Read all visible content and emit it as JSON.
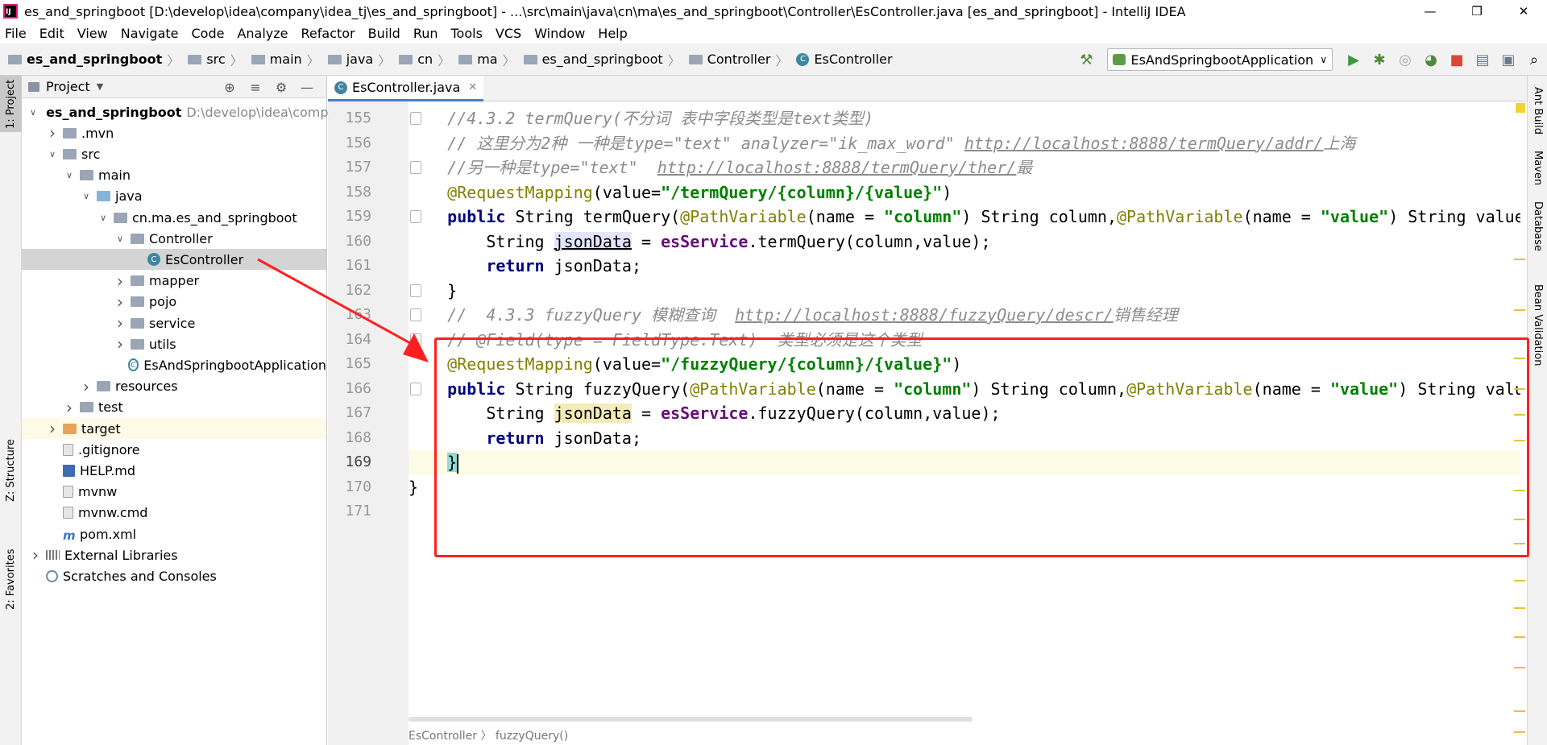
{
  "window": {
    "title": "es_and_springboot [D:\\develop\\idea\\company\\idea_tj\\es_and_springboot] - ...\\src\\main\\java\\cn\\ma\\es_and_springboot\\Controller\\EsController.java [es_and_springboot] - IntelliJ IDEA",
    "app_icon_label": "IJ"
  },
  "menu": [
    "File",
    "Edit",
    "View",
    "Navigate",
    "Code",
    "Analyze",
    "Refactor",
    "Build",
    "Run",
    "Tools",
    "VCS",
    "Window",
    "Help"
  ],
  "breadcrumb": [
    "es_and_springboot",
    "src",
    "main",
    "java",
    "cn",
    "ma",
    "es_and_springboot",
    "Controller",
    "EsController"
  ],
  "run_config": "EsAndSpringbootApplication",
  "left_strip": {
    "project": "1: Project",
    "structure": "Z: Structure",
    "favorites": "2: Favorites"
  },
  "right_strip": [
    "Ant Build",
    "Maven",
    "Database",
    "Bean Validation"
  ],
  "project_panel": {
    "title": "Project",
    "tree": [
      {
        "label": "es_and_springboot",
        "extra": "D:\\develop\\idea\\company",
        "depth": 0,
        "arrow": "down",
        "icon": "grey",
        "bold": true
      },
      {
        "label": ".mvn",
        "depth": 1,
        "arrow": "right",
        "icon": "grey"
      },
      {
        "label": "src",
        "depth": 1,
        "arrow": "down",
        "icon": "grey"
      },
      {
        "label": "main",
        "depth": 2,
        "arrow": "down",
        "icon": "grey"
      },
      {
        "label": "java",
        "depth": 3,
        "arrow": "down",
        "icon": "blue"
      },
      {
        "label": "cn.ma.es_and_springboot",
        "depth": 4,
        "arrow": "down",
        "icon": "grey"
      },
      {
        "label": "Controller",
        "depth": 5,
        "arrow": "down",
        "icon": "grey"
      },
      {
        "label": "EsController",
        "depth": 6,
        "arrow": "",
        "icon": "class",
        "selected": true
      },
      {
        "label": "mapper",
        "depth": 5,
        "arrow": "right",
        "icon": "grey"
      },
      {
        "label": "pojo",
        "depth": 5,
        "arrow": "right",
        "icon": "grey"
      },
      {
        "label": "service",
        "depth": 5,
        "arrow": "right",
        "icon": "grey"
      },
      {
        "label": "utils",
        "depth": 5,
        "arrow": "right",
        "icon": "grey"
      },
      {
        "label": "EsAndSpringbootApplication",
        "depth": 5,
        "arrow": "",
        "icon": "app"
      },
      {
        "label": "resources",
        "depth": 3,
        "arrow": "right",
        "icon": "grey"
      },
      {
        "label": "test",
        "depth": 2,
        "arrow": "right",
        "icon": "grey"
      },
      {
        "label": "target",
        "depth": 1,
        "arrow": "right",
        "icon": "orange",
        "highlight": true
      },
      {
        "label": ".gitignore",
        "depth": 1,
        "arrow": "",
        "icon": "file"
      },
      {
        "label": "HELP.md",
        "depth": 1,
        "arrow": "",
        "icon": "md"
      },
      {
        "label": "mvnw",
        "depth": 1,
        "arrow": "",
        "icon": "file"
      },
      {
        "label": "mvnw.cmd",
        "depth": 1,
        "arrow": "",
        "icon": "file"
      },
      {
        "label": "pom.xml",
        "depth": 1,
        "arrow": "",
        "icon": "m"
      },
      {
        "label": "External Libraries",
        "depth": 0,
        "arrow": "right",
        "icon": "lib"
      },
      {
        "label": "Scratches and Consoles",
        "depth": 0,
        "arrow": "",
        "icon": "scr"
      }
    ]
  },
  "editor": {
    "tab": "EsController.java",
    "current_line": 169,
    "lines": [
      {
        "n": 155,
        "fold": true,
        "segs": [
          [
            "cm",
            "    //4.3.2 termQuery(不分词 表中字段类型是text类型)"
          ]
        ]
      },
      {
        "n": 156,
        "segs": [
          [
            "cm",
            "    // 这里分为2种 一种是type=\"text\" analyzer=\"ik_max_word\" "
          ],
          [
            "cmu",
            "http://localhost:8888/termQuery/addr/"
          ],
          [
            "cm",
            "上海"
          ]
        ]
      },
      {
        "n": 157,
        "fold": true,
        "segs": [
          [
            "cm",
            "    //另一种是type=\"text\"  "
          ],
          [
            "cmu",
            "http://localhost:8888/termQuery/ther/"
          ],
          [
            "cm",
            "最"
          ]
        ]
      },
      {
        "n": 158,
        "segs": [
          [
            "an",
            "    @RequestMapping"
          ],
          [
            "",
            "(value="
          ],
          [
            "st",
            "\"/termQuery/{column}/{value}\""
          ],
          [
            "",
            ")"
          ]
        ]
      },
      {
        "n": 159,
        "fold": true,
        "segs": [
          [
            "kw",
            "    public "
          ],
          [
            "",
            "String termQuery("
          ],
          [
            "an",
            "@PathVariable"
          ],
          [
            "",
            "(name = "
          ],
          [
            "st",
            "\"column\""
          ],
          [
            "",
            ") String column,"
          ],
          [
            "an",
            "@PathVariable"
          ],
          [
            "",
            "(name = "
          ],
          [
            "st",
            "\"value\""
          ],
          [
            "",
            ") String value){"
          ]
        ]
      },
      {
        "n": 160,
        "segs": [
          [
            "",
            "        String "
          ],
          [
            "varu",
            "jsonData"
          ],
          [
            "",
            " = "
          ],
          [
            "fld",
            "esService"
          ],
          [
            "",
            ".termQuery(column,value);"
          ]
        ]
      },
      {
        "n": 161,
        "segs": [
          [
            "kw",
            "        return "
          ],
          [
            "",
            "jsonData;"
          ]
        ]
      },
      {
        "n": 162,
        "fold": true,
        "segs": [
          [
            "",
            "    }"
          ]
        ]
      },
      {
        "n": 163,
        "fold": true,
        "segs": [
          [
            "cm",
            "    //  4.3.3 fuzzyQuery 模糊查询  "
          ],
          [
            "cmu",
            "http://localhost:8888/fuzzyQuery/descr/"
          ],
          [
            "cm",
            "销售经理"
          ]
        ]
      },
      {
        "n": 164,
        "fold": true,
        "segs": [
          [
            "cm",
            "    // @Field(type = FieldType.Text)  类型必须是这个类型"
          ]
        ]
      },
      {
        "n": 165,
        "segs": [
          [
            "an",
            "    @RequestMapping"
          ],
          [
            "",
            "(value="
          ],
          [
            "st",
            "\"/fuzzyQuery/{column}/{value}\""
          ],
          [
            "",
            ")"
          ]
        ]
      },
      {
        "n": 166,
        "fold": true,
        "segs": [
          [
            "kw",
            "    public "
          ],
          [
            "",
            "String fuzzyQuery("
          ],
          [
            "an",
            "@PathVariable"
          ],
          [
            "",
            "(name = "
          ],
          [
            "st",
            "\"column\""
          ],
          [
            "",
            ") String column,"
          ],
          [
            "an",
            "@PathVariable"
          ],
          [
            "",
            "(name = "
          ],
          [
            "st",
            "\"value\""
          ],
          [
            "",
            ") String value){"
          ]
        ]
      },
      {
        "n": 167,
        "segs": [
          [
            "",
            "        String "
          ],
          [
            "var",
            "jsonData"
          ],
          [
            "",
            " = "
          ],
          [
            "fld",
            "esService"
          ],
          [
            "",
            ".fuzzyQuery(column,value);"
          ]
        ]
      },
      {
        "n": 168,
        "segs": [
          [
            "kw",
            "        return "
          ],
          [
            "",
            "jsonData;"
          ]
        ]
      },
      {
        "n": 169,
        "fold": true,
        "segs": [
          [
            "",
            "    "
          ],
          [
            "brace",
            "}"
          ],
          [
            "caret",
            ""
          ]
        ]
      },
      {
        "n": 170,
        "segs": [
          [
            "",
            "}"
          ]
        ]
      },
      {
        "n": 171,
        "segs": [
          [
            "",
            ""
          ]
        ]
      }
    ],
    "bottom_breadcrumb": "EsController  〉 fuzzyQuery()"
  },
  "colors": {
    "annotation_box": "#ff1f1f",
    "tab_underline": "#4083c9"
  }
}
